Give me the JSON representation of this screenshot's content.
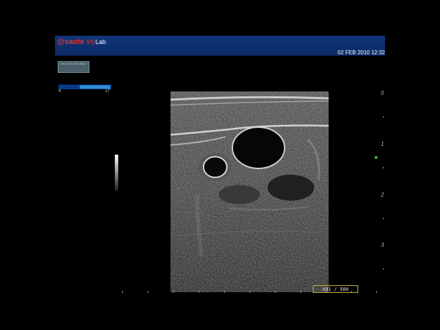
{
  "header": {
    "brand_at": "@",
    "brand": "saote",
    "brand_my": "My",
    "brand_lab": "Lab",
    "datetime": "02 FEB 2010 12:32"
  },
  "preset_button": {
    "label": "Nec & Ana Ser Musc"
  },
  "frequency_bar": {
    "min": "4",
    "max": "17",
    "fill_fraction_start": 0.4,
    "fill_fraction_end": 0.97
  },
  "depth_scale": {
    "labels": [
      "0",
      "1",
      "2",
      "3"
    ]
  },
  "frame_counter": {
    "text": "491 / 500"
  },
  "colors": {
    "header_bg": "#0b2a66",
    "brand_red": "#e0342b",
    "freq_fill": "#2e8fd6",
    "focus_marker": "#2ad82a",
    "counter_border": "#c9b52e"
  }
}
